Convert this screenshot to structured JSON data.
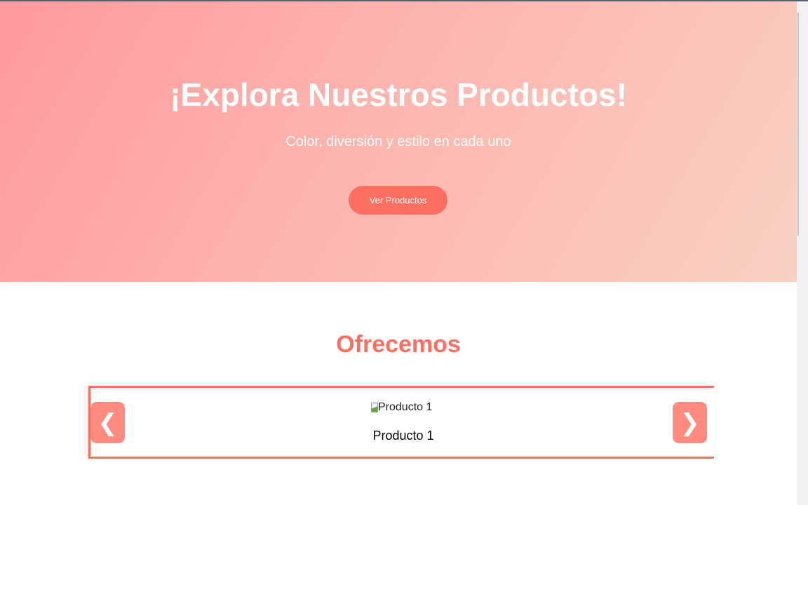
{
  "hero": {
    "title": "¡Explora Nuestros Productos!",
    "subtitle": "Color, diversión y estilo en cada uno",
    "button": "Ver Productos"
  },
  "section": {
    "title": "Ofrecemos"
  },
  "carousel": {
    "prev": "❮",
    "next": "❯",
    "items": [
      {
        "alt": "Producto 1",
        "caption": "Producto 1"
      }
    ]
  },
  "colors": {
    "accent": "#ff6f61",
    "nav": "#ff8a80"
  }
}
